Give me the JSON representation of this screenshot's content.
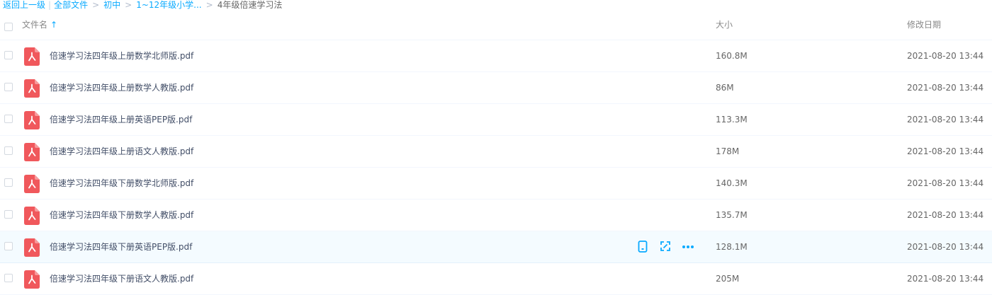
{
  "breadcrumb": {
    "back": "返回上一级",
    "items": [
      "全部文件",
      "初中",
      "1~12年级小学..."
    ],
    "current": "4年级倍速学习法"
  },
  "header": {
    "name": "文件名",
    "sort_arrow": "↑",
    "size": "大小",
    "date": "修改日期"
  },
  "files": [
    {
      "name": "倍速学习法四年级上册数学北师版.pdf",
      "size": "160.8M",
      "date": "2021-08-20 13:44"
    },
    {
      "name": "倍速学习法四年级上册数学人教版.pdf",
      "size": "86M",
      "date": "2021-08-20 13:44"
    },
    {
      "name": "倍速学习法四年级上册英语PEP版.pdf",
      "size": "113.3M",
      "date": "2021-08-20 13:44"
    },
    {
      "name": "倍速学习法四年级上册语文人教版.pdf",
      "size": "178M",
      "date": "2021-08-20 13:44"
    },
    {
      "name": "倍速学习法四年级下册数学北师版.pdf",
      "size": "140.3M",
      "date": "2021-08-20 13:44"
    },
    {
      "name": "倍速学习法四年级下册数学人教版.pdf",
      "size": "135.7M",
      "date": "2021-08-20 13:44"
    },
    {
      "name": "倍速学习法四年级下册英语PEP版.pdf",
      "size": "128.1M",
      "date": "2021-08-20 13:44"
    },
    {
      "name": "倍速学习法四年级下册语文人教版.pdf",
      "size": "205M",
      "date": "2021-08-20 13:44"
    }
  ],
  "hovered_row": 6,
  "row_actions": [
    "phone-icon",
    "share-link-icon",
    "more-icon"
  ],
  "colors": {
    "accent": "#09aaff",
    "pdf": "#f0585c",
    "hover_bg": "#f4fbff"
  }
}
